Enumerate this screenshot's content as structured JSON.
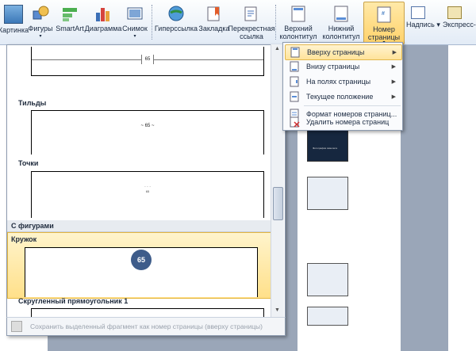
{
  "ribbon": {
    "buttons": [
      {
        "label": "Картинка"
      },
      {
        "label": "Фигуры",
        "dropdown": true
      },
      {
        "label": "SmartArt"
      },
      {
        "label": "Диаграмма"
      },
      {
        "label": "Снимок",
        "dropdown": true
      },
      {
        "label": "Гиперссылка"
      },
      {
        "label": "Закладка"
      },
      {
        "label": "Перекрестная",
        "label2": "ссылка"
      },
      {
        "label": "Верхний",
        "label2": "колонтитул",
        "dropdown": true
      },
      {
        "label": "Нижний",
        "label2": "колонтитул",
        "dropdown": true
      },
      {
        "label": "Номер",
        "label2": "страницы",
        "dropdown": true
      },
      {
        "label": "Надпись",
        "dropdown": true
      },
      {
        "label": "Экспресс-бл",
        "dropdown": true
      }
    ]
  },
  "menu": {
    "items": [
      {
        "label": "Вверху страницы",
        "submenu": true
      },
      {
        "label": "Внизу страницы",
        "submenu": true
      },
      {
        "label": "На полях страницы",
        "submenu": true
      },
      {
        "label": "Текущее положение",
        "submenu": true
      },
      {
        "label": "Формат номеров страниц..."
      },
      {
        "label": "Удалить номера страниц"
      }
    ]
  },
  "gallery": {
    "sample_number": "65",
    "tilde_number": "~ 65 ~",
    "dots_mark": "· · ·",
    "dots_number": "65",
    "items": [
      {
        "label": "Тильды"
      },
      {
        "label": "Точки"
      },
      {
        "label": "Кружок"
      },
      {
        "label": "Скругленный прямоугольник 1"
      }
    ],
    "section": "С фигурами",
    "footer": "Сохранить выделенный фрагмент как номер страницы (вверху страницы)"
  },
  "document": {
    "caption": "Фотография самолета"
  },
  "colors": {
    "accent": "#ffd26b",
    "circle": "#3e5c8a"
  }
}
